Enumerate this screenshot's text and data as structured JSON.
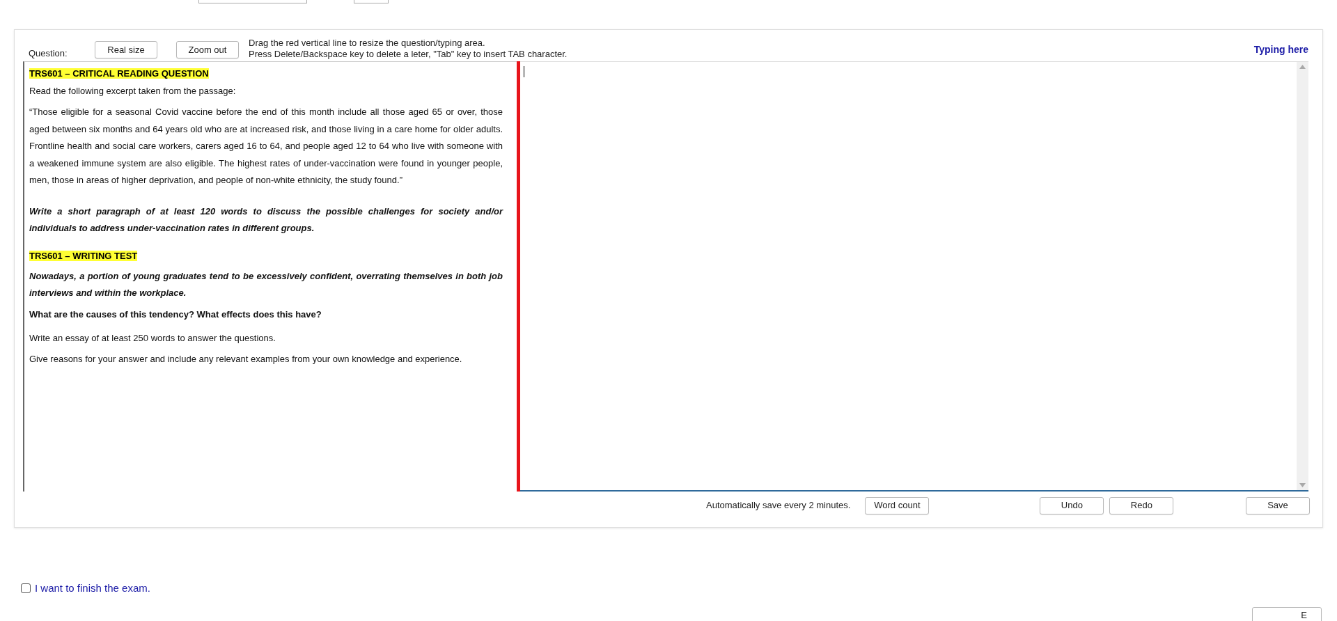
{
  "toolbar": {
    "question_label": "Question:",
    "buttons": [
      "Real size",
      "Zoom out"
    ],
    "hints": [
      "Drag the red vertical line to resize the question/typing area.",
      "Press Delete/Backspace key to delete a leter, \"Tab\" key to insert TAB character."
    ],
    "typing_label": "Typing here"
  },
  "question_pane": {
    "blocks": [
      {
        "kind": "heading",
        "text": "TRS601 – CRITICAL READING QUESTION"
      },
      {
        "kind": "text",
        "text": "Read the following excerpt taken from the passage:"
      },
      {
        "kind": "quote",
        "text": "“Those eligible for a seasonal Covid vaccine before the end of this month include all those aged 65 or over, those aged between six months and 64 years old who are at increased risk, and those living in a care home for older adults. Frontline health and social care workers, carers aged 16 to 64, and people aged 12 to 64 who live with someone with a weakened immune system are also eligible. The highest rates of under-vaccination were found in younger people, men, those in areas of higher deprivation, and people of non-white ethnicity, the study found.”"
      },
      {
        "kind": "instruction",
        "text": "Write a short paragraph of at least 120 words to discuss the possible challenges for society and/or individuals to address under-vaccination rates in different groups."
      },
      {
        "kind": "heading",
        "text": "TRS601 – WRITING TEST"
      },
      {
        "kind": "instruction",
        "text": "Nowadays, a portion of young graduates tend to be excessively confident, overrating themselves in both job interviews and within the workplace."
      },
      {
        "kind": "question",
        "text": "What are the causes of this tendency? What effects does this have?"
      },
      {
        "kind": "text",
        "text": "Write an essay of at least 250 words to answer the questions."
      },
      {
        "kind": "text",
        "text": "Give reasons for your answer and include any relevant examples from your own knowledge and experience."
      }
    ]
  },
  "bottom_bar": {
    "autosave_note": "Automatically save every 2 minutes.",
    "word_count_button": "Word count",
    "undo_button": "Undo",
    "redo_button": "Redo",
    "save_button": "Save"
  },
  "finish": {
    "label": "I want to finish the exam.",
    "checked": false
  },
  "corner_button": "E"
}
